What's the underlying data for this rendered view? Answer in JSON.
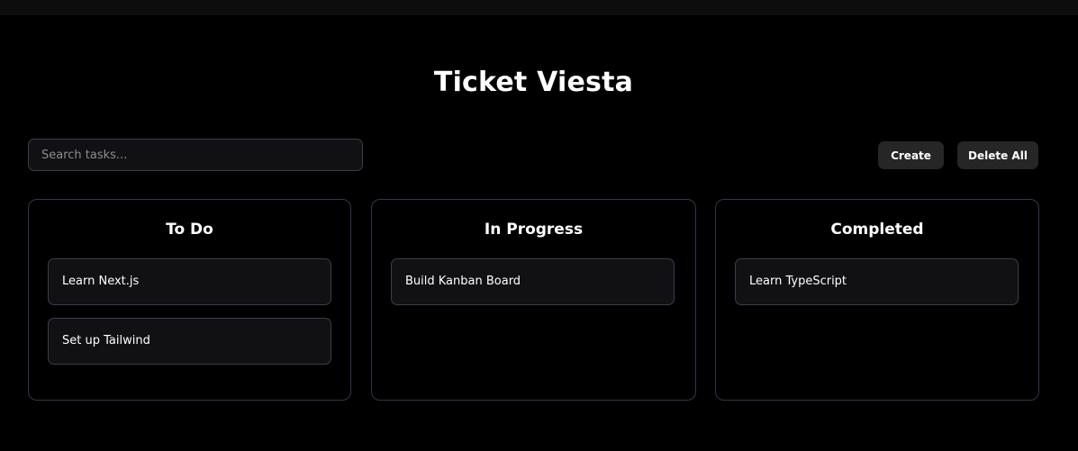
{
  "app": {
    "title": "Ticket Viesta"
  },
  "toolbar": {
    "search_placeholder": "Search tasks...",
    "search_value": "",
    "create_label": "Create",
    "delete_all_label": "Delete All"
  },
  "columns": [
    {
      "title": "To Do",
      "tasks": [
        "Learn Next.js",
        "Set up Tailwind"
      ]
    },
    {
      "title": "In Progress",
      "tasks": [
        "Build Kanban Board"
      ]
    },
    {
      "title": "Completed",
      "tasks": [
        "Learn TypeScript"
      ]
    }
  ],
  "colors": {
    "background": "#000000",
    "panel": "#111113",
    "border": "#3b3d4c",
    "button": "#262626",
    "text": "#ffffff"
  }
}
